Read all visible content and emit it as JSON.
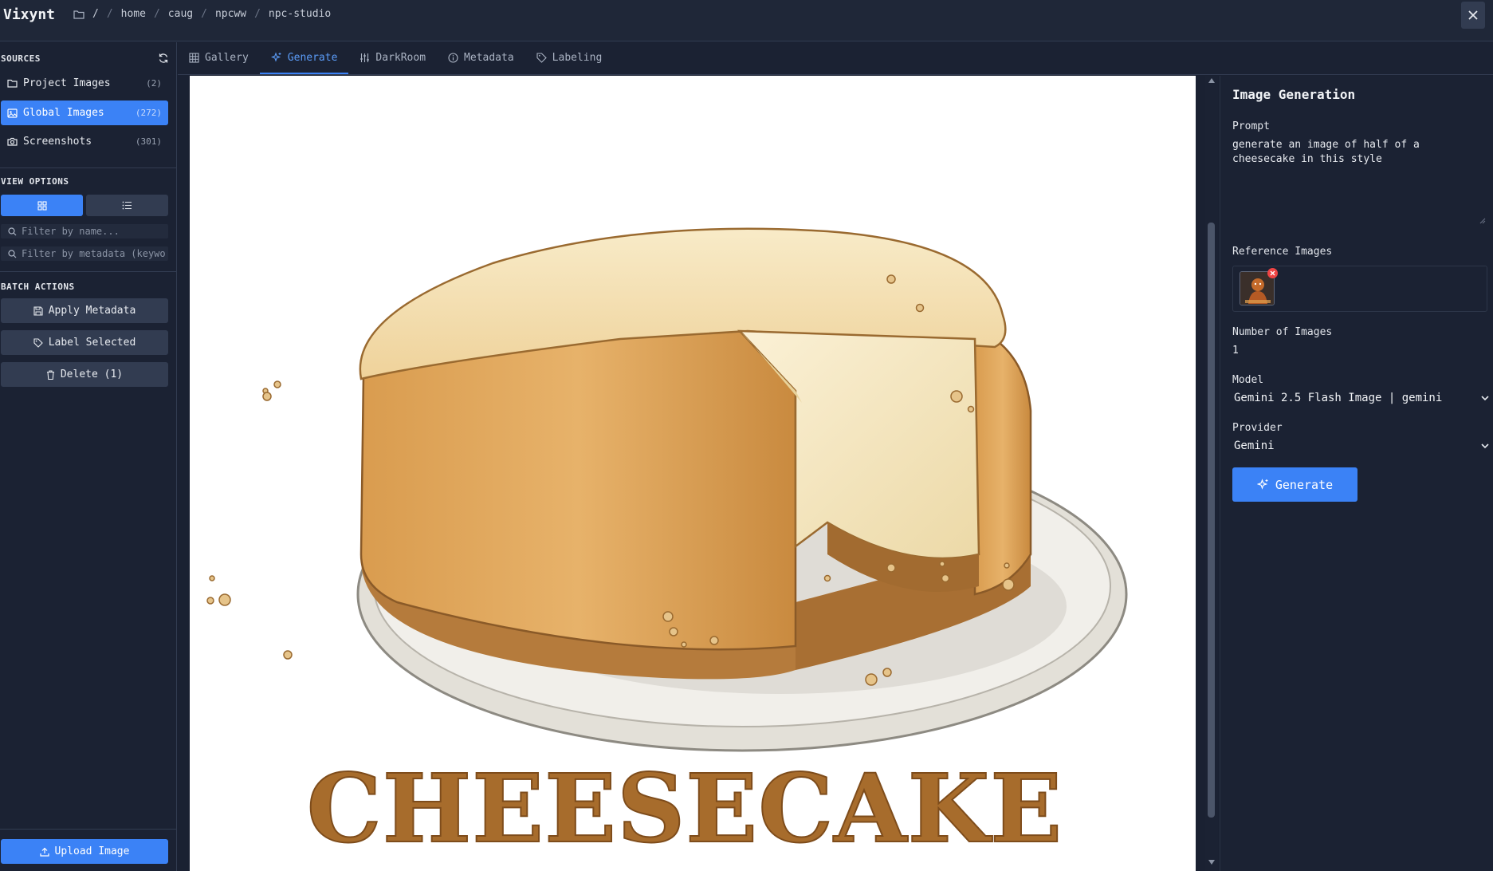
{
  "app": {
    "title": "Vixynt"
  },
  "breadcrumb": {
    "root": "/",
    "parts": [
      "home",
      "caug",
      "npcww",
      "npc-studio"
    ]
  },
  "sidebar": {
    "sources_title": "SOURCES",
    "sources": [
      {
        "label": "Project Images",
        "count": "(2)",
        "icon": "folder-icon",
        "active": false
      },
      {
        "label": "Global Images",
        "count": "(272)",
        "icon": "image-icon",
        "active": true
      },
      {
        "label": "Screenshots",
        "count": "(301)",
        "icon": "camera-icon",
        "active": false
      }
    ],
    "view_options_title": "VIEW OPTIONS",
    "filter_name_placeholder": "Filter by name...",
    "filter_meta_placeholder": "Filter by metadata (keywords...)",
    "batch_actions_title": "BATCH ACTIONS",
    "batch": {
      "apply_metadata": "Apply Metadata",
      "label_selected": "Label Selected",
      "delete": "Delete (1)"
    },
    "upload": "Upload Image"
  },
  "tabs": [
    {
      "label": "Gallery",
      "icon": "grid-icon",
      "active": false
    },
    {
      "label": "Generate",
      "icon": "sparkle-icon",
      "active": true
    },
    {
      "label": "DarkRoom",
      "icon": "sliders-icon",
      "active": false
    },
    {
      "label": "Metadata",
      "icon": "info-icon",
      "active": false
    },
    {
      "label": "Labeling",
      "icon": "tag-icon",
      "active": false
    }
  ],
  "canvas": {
    "image_text": "CHEESECAKE"
  },
  "panel": {
    "title": "Image Generation",
    "prompt_label": "Prompt",
    "prompt_value": "generate an image of half of a cheesecake in this style",
    "reference_label": "Reference Images",
    "num_images_label": "Number of Images",
    "num_images_value": "1",
    "model_label": "Model",
    "model_value": "Gemini 2.5 Flash Image | gemini",
    "provider_label": "Provider",
    "provider_value": "Gemini",
    "generate_label": "Generate"
  },
  "colors": {
    "accent": "#3b82f6",
    "background": "#1a2132",
    "panel": "#1b2233",
    "danger": "#ef4444"
  }
}
